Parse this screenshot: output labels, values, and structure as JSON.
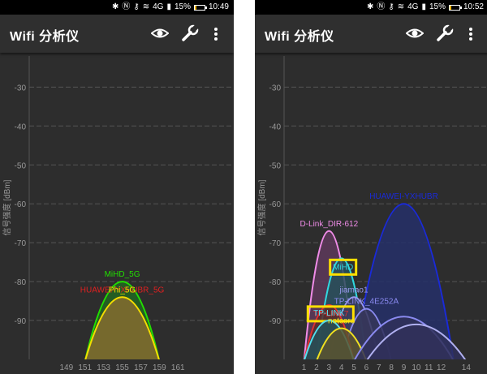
{
  "screens": [
    {
      "status": {
        "battery": "15%",
        "time": "10:49",
        "battery_level": 0.15,
        "net": "4G"
      },
      "app_title": "Wifi 分析仪",
      "chart_data": {
        "type": "area",
        "ylabel": "信号强度 [dBm]",
        "ylim": [
          -100,
          -22
        ],
        "y_ticks": [
          -30,
          -40,
          -50,
          -60,
          -70,
          -80,
          -90
        ],
        "xlim": [
          145,
          167
        ],
        "x_ticks": [
          149,
          151,
          153,
          155,
          157,
          159,
          161
        ],
        "grid": true,
        "series": [
          {
            "name": "MiHD_5G",
            "center": 155,
            "width": 8,
            "peak": -80,
            "color": "#22e000",
            "fill": "#226622"
          },
          {
            "name": "HUAWEI-YXHUBR_5G",
            "center": 155,
            "width": 8,
            "peak": -84,
            "color": "#e02020",
            "fill": "#7a6520"
          },
          {
            "name": "Phi_5G",
            "center": 155,
            "width": 8,
            "peak": -84,
            "color": "#f0e000",
            "fill": "#786a30"
          }
        ]
      }
    },
    {
      "status": {
        "battery": "15%",
        "time": "10:52",
        "battery_level": 0.15,
        "net": "4G"
      },
      "app_title": "Wifi 分析仪",
      "chart_data": {
        "type": "area",
        "ylabel": "信号强度 [dBm]",
        "ylim": [
          -100,
          -22
        ],
        "y_ticks": [
          -30,
          -40,
          -50,
          -60,
          -70,
          -80,
          -90
        ],
        "xlim": [
          -0.6,
          15.8
        ],
        "x_ticks": [
          1,
          2,
          3,
          4,
          5,
          6,
          7,
          8,
          9,
          10,
          11,
          12,
          14
        ],
        "grid": true,
        "series": [
          {
            "name": "HUAWEI-YXHUBR",
            "center": 9,
            "width": 8,
            "peak": -60,
            "color": "#1a2ad8",
            "fill": "#26306a"
          },
          {
            "name": "D-Link_DIR-612",
            "center": 3,
            "width": 4,
            "peak": -67,
            "color": "#f08ce8",
            "fill": "#5e3a5c"
          },
          {
            "name": "MiHD",
            "center": 4,
            "width": 4,
            "peak": -74,
            "color": "#30d8e0",
            "fill": "#26505a"
          },
          {
            "name": "jiamao1",
            "center": 5,
            "width": 4,
            "peak": -84,
            "color": "#9a9af0",
            "fill": "#3a3a5a"
          },
          {
            "name": "TP-LINK_4E252A",
            "center": 6,
            "width": 4,
            "peak": -87,
            "color": "#8a8af0",
            "fill": "#36365a"
          },
          {
            "name": "TP-LINK7",
            "center": 3,
            "width": 4,
            "peak": -86,
            "color": "#e03030",
            "fill": "#5a2a2a"
          },
          {
            "name": "TP-LINK",
            "center": 3,
            "width": 4,
            "peak": -90,
            "color": "#50e0f0",
            "fill": "#245058"
          },
          {
            "name": "netcore",
            "center": 4,
            "width": 4,
            "peak": -92,
            "color": "#f0e020",
            "fill": "#5a5430"
          },
          {
            "name": "",
            "center": 9,
            "width": 8,
            "peak": -89,
            "color": "#8a8af0",
            "fill": "#30305a"
          },
          {
            "name": "",
            "center": 10,
            "width": 8,
            "peak": -91,
            "color": "#b0b0f0",
            "fill": "#30305a"
          }
        ],
        "highlight_boxes": [
          "MiHD",
          "TP-LINK7"
        ]
      }
    }
  ],
  "colors": {
    "background": "#2d2d2d",
    "grid": "#555555",
    "tick_label": "#999999",
    "highlight": "#ffe000"
  },
  "icons": {
    "eye": "eye-icon",
    "wrench": "wrench-icon",
    "menu": "more-vert-icon"
  }
}
